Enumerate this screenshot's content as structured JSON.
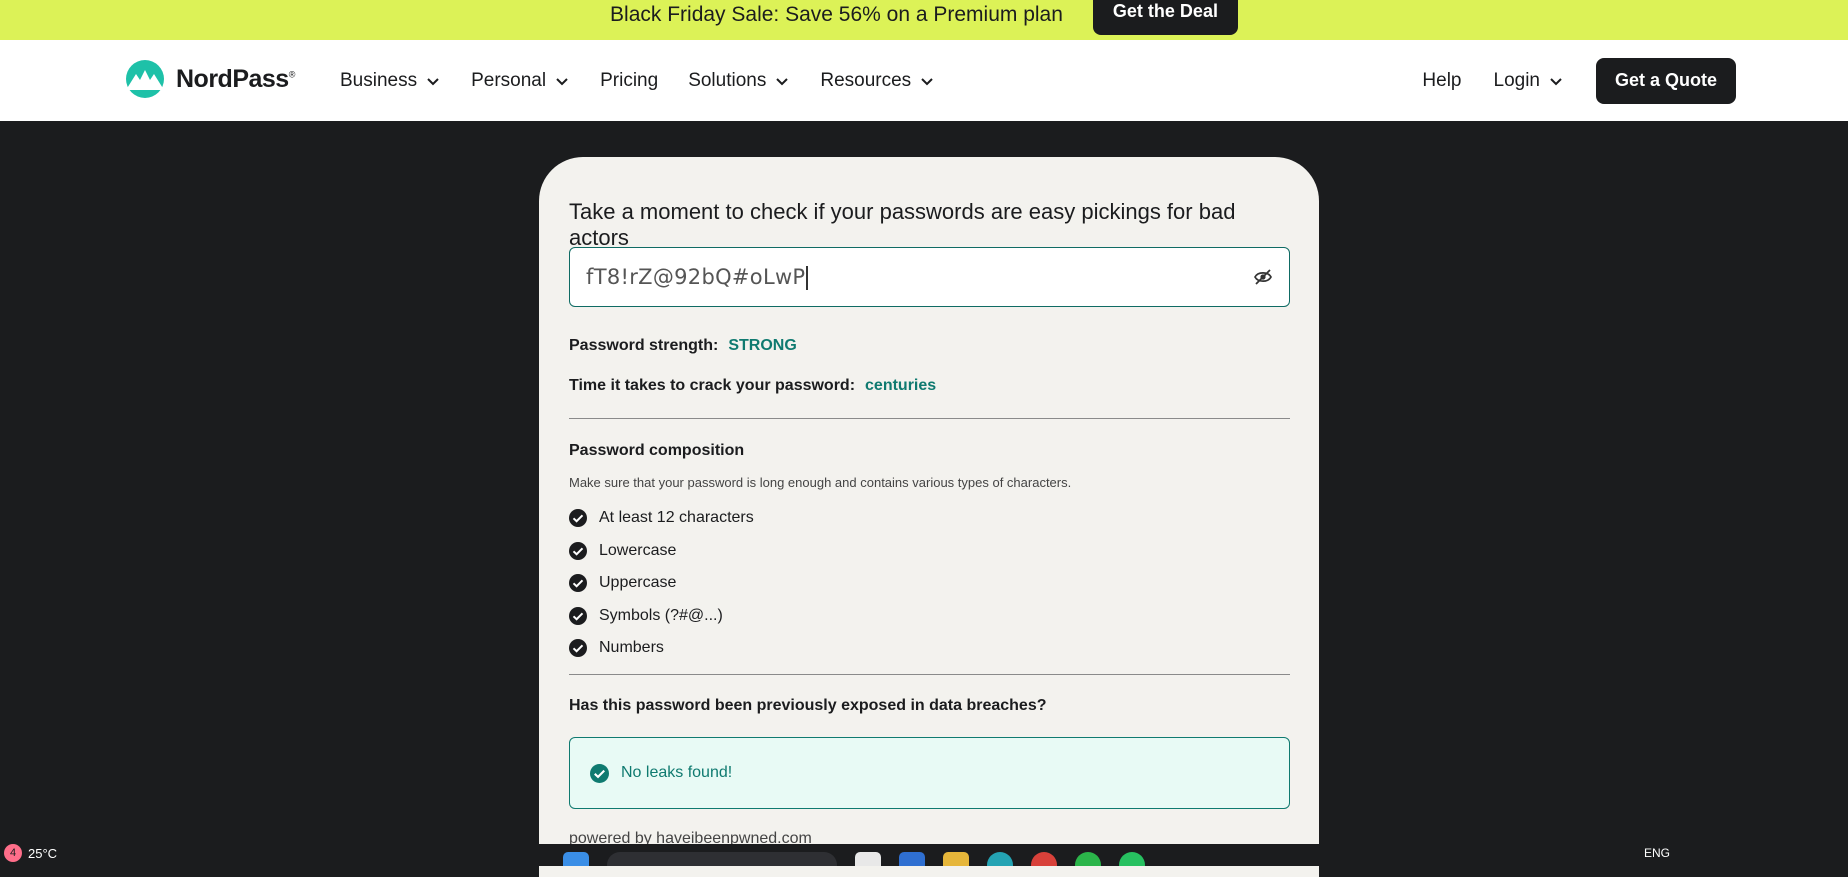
{
  "promo": {
    "text": "Black Friday Sale: Save 56% on a Premium plan",
    "button": "Get the Deal"
  },
  "nav": {
    "brand": "NordPass",
    "brand_mark": "®",
    "items": [
      "Business",
      "Personal",
      "Pricing",
      "Solutions",
      "Resources"
    ],
    "help": "Help",
    "login": "Login",
    "cta": "Get a Quote"
  },
  "checker": {
    "headline": "Take a moment to check if your passwords are easy pickings for bad actors",
    "password_value": "fT8!rZ@92bQ#oLwP",
    "strength_label": "Password strength:",
    "strength_value": "STRONG",
    "crack_label": "Time it takes to crack your password:",
    "crack_value": "centuries",
    "composition_title": "Password composition",
    "composition_desc": "Make sure that your password is long enough and contains various types of characters.",
    "criteria": [
      "At least 12 characters",
      "Lowercase",
      "Uppercase",
      "Symbols (?#@...)",
      "Numbers"
    ],
    "breach_question": "Has this password been previously exposed in data breaches?",
    "leak_result": "No leaks found!",
    "powered_by": "powered by haveibeenpwned.com"
  },
  "taskbar": {
    "badge": "4",
    "temp": "25°C",
    "lang": "ENG"
  },
  "colors": {
    "accent_teal": "#0f7a70",
    "promo_bg": "#dcf257",
    "page_bg": "#1b1c1e"
  }
}
